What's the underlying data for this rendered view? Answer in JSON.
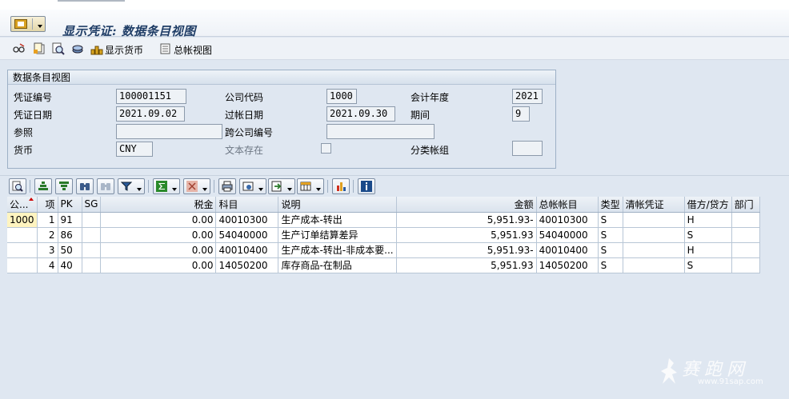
{
  "title": "显示凭证: 数据条目视图",
  "app_toolbar": {
    "items": [
      {
        "icon": "glasses-change-icon"
      },
      {
        "icon": "document-copy-icon"
      },
      {
        "icon": "magnifier-document-icon"
      },
      {
        "icon": "layers-icon"
      },
      {
        "icon": "currency-coins-icon",
        "label": "显示货币"
      },
      {
        "icon": "ledger-icon",
        "label": "总帐视图"
      }
    ]
  },
  "header": {
    "group_title": "数据条目视图",
    "doc_number_label": "凭证编号",
    "doc_number": "100001151",
    "company_code_label": "公司代码",
    "company_code": "1000",
    "fiscal_year_label": "会计年度",
    "fiscal_year": "2021",
    "doc_date_label": "凭证日期",
    "doc_date": "2021.09.02",
    "posting_date_label": "过帐日期",
    "posting_date": "2021.09.30",
    "period_label": "期间",
    "period": "9",
    "reference_label": "参照",
    "reference": "",
    "cross_company_label": "跨公司编号",
    "cross_company": "",
    "currency_label": "货币",
    "currency": "CNY",
    "text_exists_label": "文本存在",
    "ledger_group_label": "分类帐组",
    "ledger_group": ""
  },
  "grid": {
    "columns": [
      "公...",
      "项",
      "PK",
      "SG",
      "税金",
      "科目",
      "说明",
      "金额",
      "总帐帐目",
      "类型",
      "清帐凭证",
      "借方/贷方",
      "部门"
    ],
    "rows": [
      {
        "company": "1000",
        "item": "1",
        "pk": "91",
        "sg": "",
        "tax": "0.00",
        "account": "40010300",
        "text": "生产成本-转出",
        "amount": "5,951.93-",
        "gl_account": "40010300",
        "type": "S",
        "clearing": "",
        "dc": "H",
        "dept": ""
      },
      {
        "company": "",
        "item": "2",
        "pk": "86",
        "sg": "",
        "tax": "0.00",
        "account": "54040000",
        "text": "生产订单结算差异",
        "amount": "5,951.93",
        "gl_account": "54040000",
        "type": "S",
        "clearing": "",
        "dc": "S",
        "dept": ""
      },
      {
        "company": "",
        "item": "3",
        "pk": "50",
        "sg": "",
        "tax": "0.00",
        "account": "40010400",
        "text": "生产成本-转出-非成本要...",
        "amount": "5,951.93-",
        "gl_account": "40010400",
        "type": "S",
        "clearing": "",
        "dc": "H",
        "dept": ""
      },
      {
        "company": "",
        "item": "4",
        "pk": "40",
        "sg": "",
        "tax": "0.00",
        "account": "14050200",
        "text": "库存商品-在制品",
        "amount": "5,951.93",
        "gl_account": "14050200",
        "type": "S",
        "clearing": "",
        "dc": "S",
        "dept": ""
      }
    ]
  },
  "watermark": {
    "text": "赛跑网",
    "url": "www.91sap.com"
  }
}
